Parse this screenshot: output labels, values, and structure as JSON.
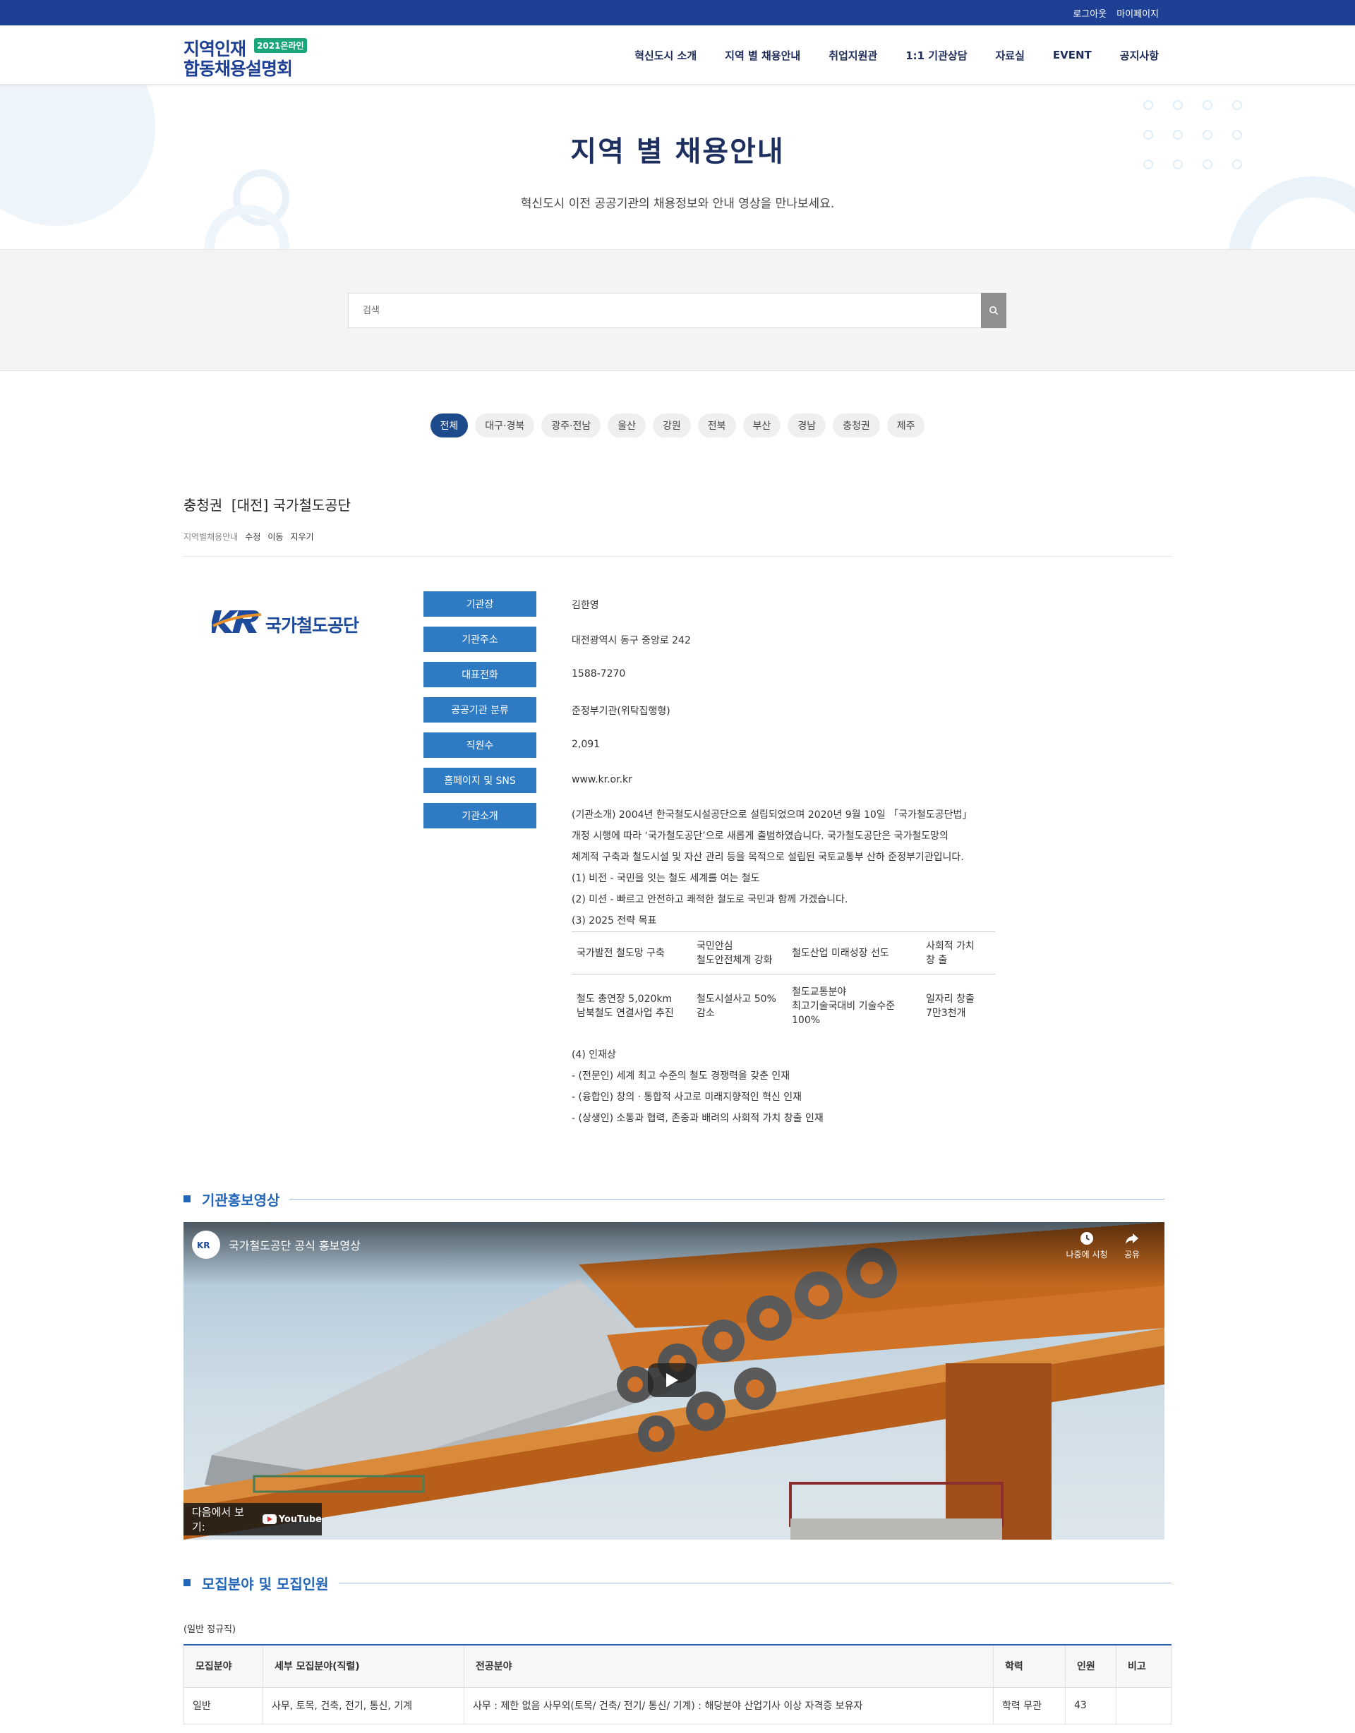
{
  "topbar": {
    "logout": "로그아웃",
    "mypage": "마이페이지"
  },
  "logo": {
    "line1": "지역인재",
    "badge": "2021온라인",
    "line2": "합동채용설명회"
  },
  "nav": [
    "혁신도시 소개",
    "지역 별 채용안내",
    "취업지원관",
    "1:1 기관상담",
    "자료실",
    "EVENT",
    "공지사항"
  ],
  "hero": {
    "title": "지역 별 채용안내",
    "subtitle": "혁신도시 이전 공공기관의 채용정보와 안내 영상을 만나보세요."
  },
  "search": {
    "placeholder": "검색"
  },
  "regions": [
    "전체",
    "대구·경북",
    "광주·전남",
    "울산",
    "강원",
    "전북",
    "부산",
    "경남",
    "충청권",
    "제주"
  ],
  "post": {
    "title": "충청권  [대전] 국가철도공단",
    "meta": {
      "board": "지역별채용안내",
      "edit": "수정",
      "move": "이동",
      "delete": "지우기"
    }
  },
  "org": {
    "logo_mark": "KR",
    "logo_name": "국가철도공단",
    "fields": [
      {
        "label": "기관장",
        "value": "김한영"
      },
      {
        "label": "기관주소",
        "value": "대전광역시 동구 중앙로 242"
      },
      {
        "label": "대표전화",
        "value": "1588-7270"
      },
      {
        "label": "공공기관 분류",
        "value": "준정부기관(위탁집행형)"
      },
      {
        "label": "직원수",
        "value": "2,091"
      },
      {
        "label": "홈페이지 및 SNS",
        "value": "www.kr.or.kr"
      },
      {
        "label": "기관소개",
        "value": ""
      }
    ],
    "intro_lines": [
      "(기관소개) 2004년 한국철도시설공단으로 설립되었으며 2020년 9월 10일 「국가철도공단법」",
      "개정 시행에 따라 ‘국가철도공단’으로 새롭게 출범하였습니다. 국가철도공단은 국가철도망의",
      "체계적 구축과 철도시설 및 자산 관리 등을 목적으로 설립된 국토교통부 산하 준정부기관입니다.",
      "(1) 비전 - 국민을 잇는 철도 세계를 여는 철도",
      "(2) 미션 - 빠르고 안전하고 쾌적한 철도로 국민과 함께 가겠습니다.",
      "(3) 2025 전략 목표"
    ],
    "goals_head": [
      "국가발전 철도망 구축",
      "국민안심\n철도안전체계 강화",
      "철도산업 미래성장 선도",
      "사회적 가치\n창 출"
    ],
    "goals_body": [
      "철도 총연장 5,020km\n남북철도 연결사업 추진",
      "철도시설사고 50%\n감소",
      "철도교통분야\n최고기술국대비 기술수준\n100%",
      "일자리 창출\n7만3천개"
    ],
    "talent_lines": [
      "(4) 인재상",
      "- (전문인) 세계 최고 수준의 철도 경쟁력을 갖춘 인재",
      "- (융합인) 창의ㆍ통합적 사고로 미래지향적인 혁신 인재",
      "- (상생인) 소통과 협력, 존중과 배려의 사회적 가치 창출 인재"
    ]
  },
  "video_section": {
    "heading": "기관홍보영상",
    "video_title": "국가철도공단 공식 홍보영상",
    "watch_later": "나중에 시청",
    "share": "공유",
    "watch_on": "다음에서 보기:",
    "youtube": "YouTube"
  },
  "recruit_section": {
    "heading": "모집분야 및 모집인원",
    "subtitle": "(일반 정규직)",
    "columns": [
      "모집분야",
      "세부 모집분야(직렬)",
      "전공분야",
      "학력",
      "인원",
      "비고"
    ],
    "rows": [
      [
        "일반",
        "사무, 토목, 건축, 전기, 통신, 기계",
        "사무 : 제한 없음 사무외(토목/ 건축/ 전기/ 통신/ 기계) : 해당분야 산업기사 이상 자격증 보유자",
        "학력 무관",
        "43",
        ""
      ]
    ]
  },
  "colors": {
    "primary": "#1d3f94",
    "accent": "#2366b8",
    "label_bg": "#2e7bc4",
    "badge": "#1aa57a"
  }
}
